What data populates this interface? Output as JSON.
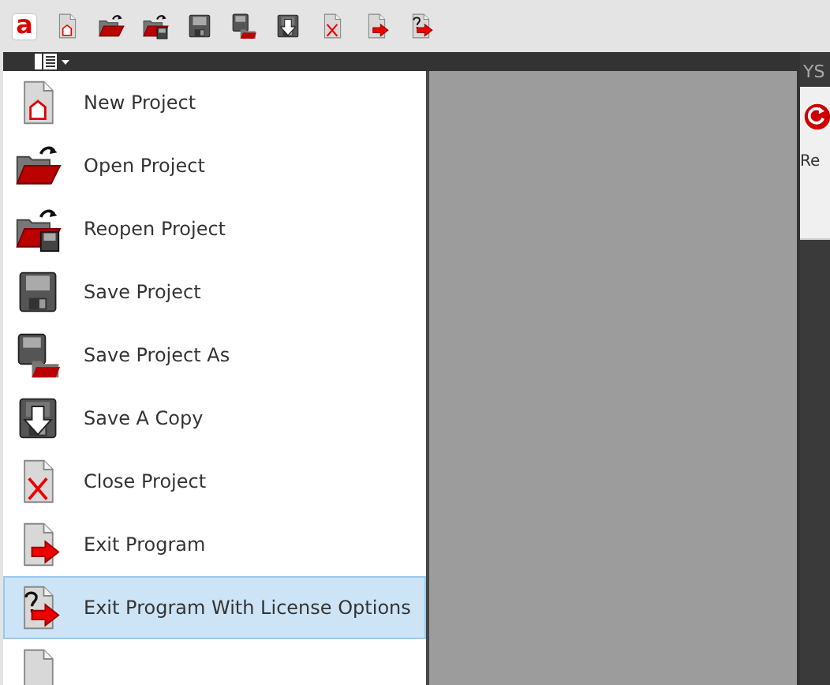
{
  "toolbar": {
    "logo": "a",
    "buttons": [
      {
        "kind": "new"
      },
      {
        "kind": "open"
      },
      {
        "kind": "reopen"
      },
      {
        "kind": "save"
      },
      {
        "kind": "save-as"
      },
      {
        "kind": "copy"
      },
      {
        "kind": "close"
      },
      {
        "kind": "exit"
      },
      {
        "kind": "exit-license"
      }
    ]
  },
  "menu": {
    "items": [
      {
        "kind": "new",
        "label": "New Project",
        "selected": false
      },
      {
        "kind": "open",
        "label": "Open Project",
        "selected": false
      },
      {
        "kind": "reopen",
        "label": "Reopen Project",
        "selected": false
      },
      {
        "kind": "save",
        "label": "Save Project",
        "selected": false
      },
      {
        "kind": "save-as",
        "label": "Save Project As",
        "selected": false
      },
      {
        "kind": "copy",
        "label": "Save A Copy",
        "selected": false
      },
      {
        "kind": "close",
        "label": "Close Project",
        "selected": false
      },
      {
        "kind": "exit",
        "label": "Exit Program",
        "selected": false
      },
      {
        "kind": "exit-license",
        "label": "Exit Program With License Options",
        "selected": true
      },
      {
        "kind": "page",
        "selected": false
      }
    ]
  },
  "background": {
    "tab_text": "YS",
    "button_label": "Re"
  }
}
